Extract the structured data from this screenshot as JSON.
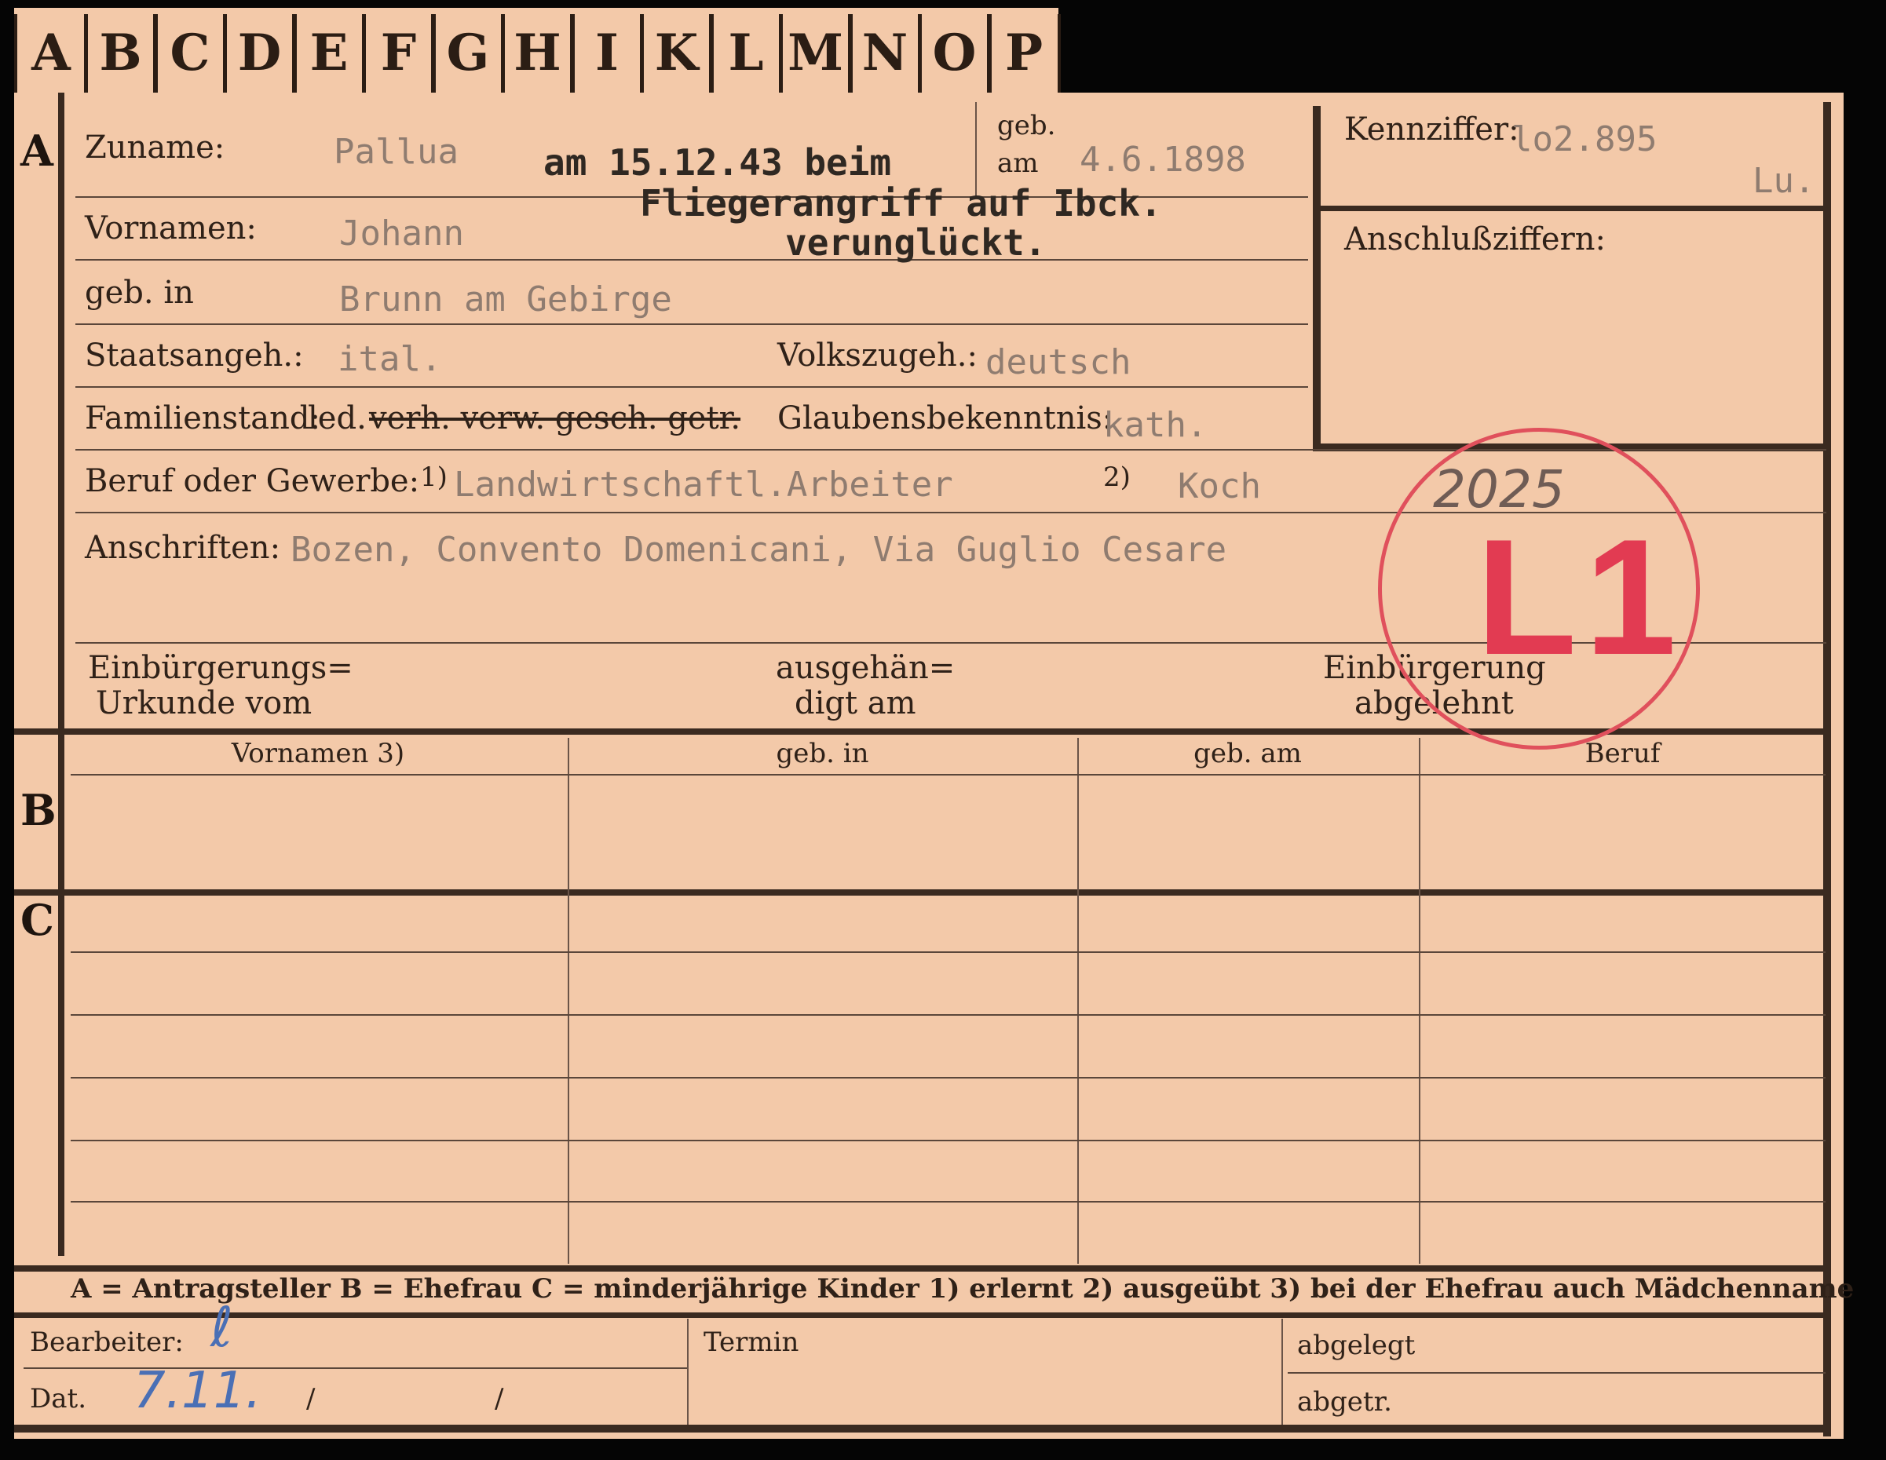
{
  "index_tabs": [
    "A",
    "B",
    "C",
    "D",
    "E",
    "F",
    "G",
    "H",
    "I",
    "K",
    "L",
    "M",
    "N",
    "O",
    "P"
  ],
  "section_markers": {
    "a": "A",
    "b": "B",
    "c": "C"
  },
  "labels": {
    "zuname": "Zuname:",
    "geb": "geb.",
    "am": "am",
    "kennziffer": "Kennziffer:",
    "vornamen": "Vornamen:",
    "anschlussziffern": "Anschlußziffern:",
    "geb_in": "geb. in",
    "staatsangeh": "Staatsangeh.:",
    "volkszugeh": "Volkszugeh.:",
    "familienstand": "Familienstand:",
    "fam_led": "led.",
    "fam_struck": "verh. verw. gesch. getr.",
    "glauben": "Glaubensbekenntnis:",
    "beruf": "Beruf oder Gewerbe:",
    "beruf_1": "1)",
    "beruf_2": "2)",
    "anschriften": "Anschriften:",
    "einbuergerung_1": "Einbürgerungs=",
    "einbuergerung_2": "Urkunde vom",
    "ausgehaen_1": "ausgehän=",
    "ausgehaen_2": "digt am",
    "abgelehnt_1": "Einbürgerung",
    "abgelehnt_2": "abgelehnt"
  },
  "values": {
    "zuname": "Pallua",
    "geb_am": "4.6.1898",
    "kennziffer": "lo2.895",
    "kennziffer_suffix": "Lu.",
    "vornamen": "Johann",
    "geb_in": "Brunn am Gebirge",
    "staatsangeh": "ital.",
    "volkszugeh": "deutsch",
    "glauben": "kath.",
    "beruf_1": "Landwirtschaftl.Arbeiter",
    "beruf_2": "Koch",
    "anschriften": "Bozen, Convento Domenicani, Via Guglio Cesare"
  },
  "typed_note": [
    "am 15.12.43 beim",
    "Fliegerangriff auf Ibck.",
    "verunglückt."
  ],
  "stamp": {
    "number": "2025",
    "code": "L1"
  },
  "table_headers": [
    "Vornamen 3)",
    "geb. in",
    "geb. am",
    "Beruf"
  ],
  "legend": "A = Antragsteller   B = Ehefrau   C = minderjährige Kinder   1) erlernt   2) ausgeübt   3) bei der Ehefrau auch Mädchenname",
  "footer": {
    "bearbeiter": "Bearbeiter:",
    "dat": "Dat.",
    "dat_value": "7.11.",
    "slash1": "/",
    "slash2": "/",
    "termin": "Termin",
    "abgelegt": "abgelegt",
    "abgetr": "abgetr."
  },
  "colors": {
    "card": "#f3c9a9",
    "ink": "#3a2a20",
    "stamp": "#e23b52",
    "typewriter": "#8f7c70",
    "pen": "#4a6fb5"
  }
}
